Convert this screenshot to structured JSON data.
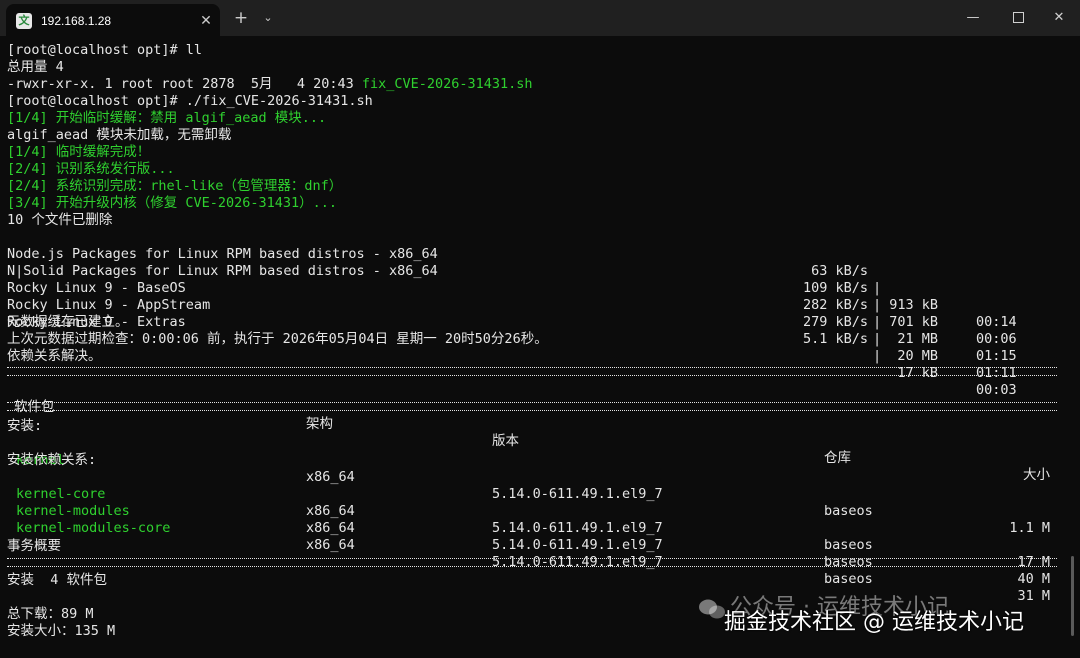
{
  "tab": {
    "title": "192.168.1.28",
    "close": "✕",
    "new_tab": "+",
    "dropdown": "⌄",
    "icon": "terminal-app-icon"
  },
  "window": {
    "minimize": "—",
    "close": "✕"
  },
  "lines": {
    "l1_prompt": "[root@localhost opt]# ll",
    "l2": "总用量 4",
    "l3_meta": "-rwxr-xr-x. 1 root root 2878  5月   4 20:43 ",
    "l3_file": "fix_CVE-2026-31431.sh",
    "l4_prompt": "[root@localhost opt]# ./fix_CVE-2026-31431.sh",
    "l5": "[1/4] 开始临时缓解：禁用 algif_aead 模块...",
    "l6": "algif_aead 模块未加载，无需卸载",
    "l7": "[1/4] 临时缓解完成！",
    "l8": "[2/4] 识别系统发行版...",
    "l9": "[2/4] 系统识别完成：rhel-like（包管理器：dnf）",
    "l10": "[3/4] 开始升级内核（修复 CVE-2026-31431）...",
    "l11": "10 个文件已删除",
    "l17": "元数据缓存已建立。",
    "l18": "上次元数据过期检查：0:00:06 前，执行于 2026年05月04日 星期一 20时50分26秒。",
    "l19": "依赖关系解决。"
  },
  "repos": [
    {
      "name": "Node.js Packages for Linux RPM based distros - x86_64",
      "speed": "63 kB/s",
      "size": "913 kB",
      "time": "00:14"
    },
    {
      "name": "N|Solid Packages for Linux RPM based distros - x86_64",
      "speed": "109 kB/s",
      "size": "701 kB",
      "time": "00:06"
    },
    {
      "name": "Rocky Linux 9 - BaseOS",
      "speed": "282 kB/s",
      "size": "21 MB",
      "time": "01:15"
    },
    {
      "name": "Rocky Linux 9 - AppStream",
      "speed": "279 kB/s",
      "size": "20 MB",
      "time": "01:11"
    },
    {
      "name": "Rocky Linux 9 - Extras",
      "speed": "5.1 kB/s",
      "size": "17 kB",
      "time": "00:03"
    }
  ],
  "pipe": "|",
  "table": {
    "headers": {
      "package": "软件包",
      "arch": "架构",
      "version": "版本",
      "repo": "仓库",
      "size": "大小"
    },
    "install_label": "安装:",
    "deps_label": "安装依赖关系:",
    "rows": [
      {
        "package": "kernel",
        "arch": "x86_64",
        "version": "5.14.0-611.49.1.el9_7",
        "repo": "baseos",
        "size": "1.1 M"
      },
      {
        "package": "kernel-core",
        "arch": "x86_64",
        "version": "5.14.0-611.49.1.el9_7",
        "repo": "baseos",
        "size": "17 M"
      },
      {
        "package": "kernel-modules",
        "arch": "x86_64",
        "version": "5.14.0-611.49.1.el9_7",
        "repo": "baseos",
        "size": "40 M"
      },
      {
        "package": "kernel-modules-core",
        "arch": "x86_64",
        "version": "5.14.0-611.49.1.el9_7",
        "repo": "baseos",
        "size": "31 M"
      }
    ]
  },
  "summary": {
    "title": "事务概要",
    "install": "安装  4 软件包",
    "download": "总下载：89 M",
    "install_size": "安装大小：135 M"
  },
  "watermark": {
    "sub": "公众号 · 运维技术小记",
    "main": "掘金技术社区 @ 运维技术小记",
    "icon": "wechat-icon"
  },
  "colors": {
    "background": "#0c0c0c",
    "text": "#e6e6e6",
    "green": "#2fd12f",
    "titlebar": "#202020"
  }
}
